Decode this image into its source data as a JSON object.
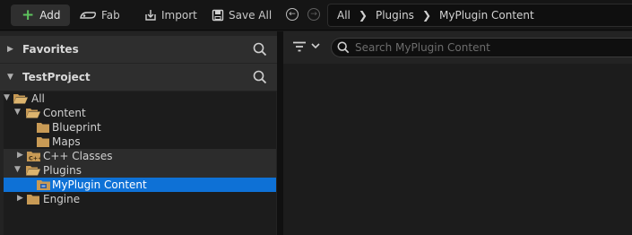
{
  "toolbar": {
    "add_label": "Add",
    "fab_label": "Fab",
    "import_label": "Import",
    "save_all_label": "Save All"
  },
  "breadcrumb": [
    "All",
    "Plugins",
    "MyPlugin Content"
  ],
  "left_panel": {
    "favorites_label": "Favorites",
    "project_label": "TestProject",
    "tree": [
      {
        "label": "All",
        "expanded": true
      },
      {
        "label": "Content",
        "expanded": true
      },
      {
        "label": "Blueprint"
      },
      {
        "label": "Maps"
      },
      {
        "label": "C++ Classes",
        "expanded": false
      },
      {
        "label": "Plugins",
        "expanded": true
      },
      {
        "label": "MyPlugin Content",
        "selected": true
      },
      {
        "label": "Engine",
        "expanded": false
      }
    ]
  },
  "content": {
    "search_placeholder": "Search MyPlugin Content"
  },
  "colors": {
    "selection": "#0e71d6",
    "add_plus": "#5ec35e",
    "folder": "#c89a55"
  }
}
